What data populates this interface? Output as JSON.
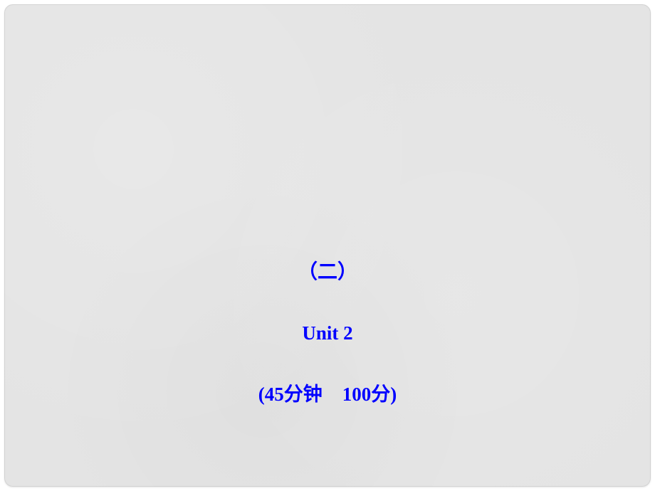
{
  "slide": {
    "section_number": "（二）",
    "unit_label": "Unit  2",
    "duration_prefix": "(45",
    "duration_unit": "分钟",
    "score_value": "100",
    "score_unit": "分)"
  }
}
